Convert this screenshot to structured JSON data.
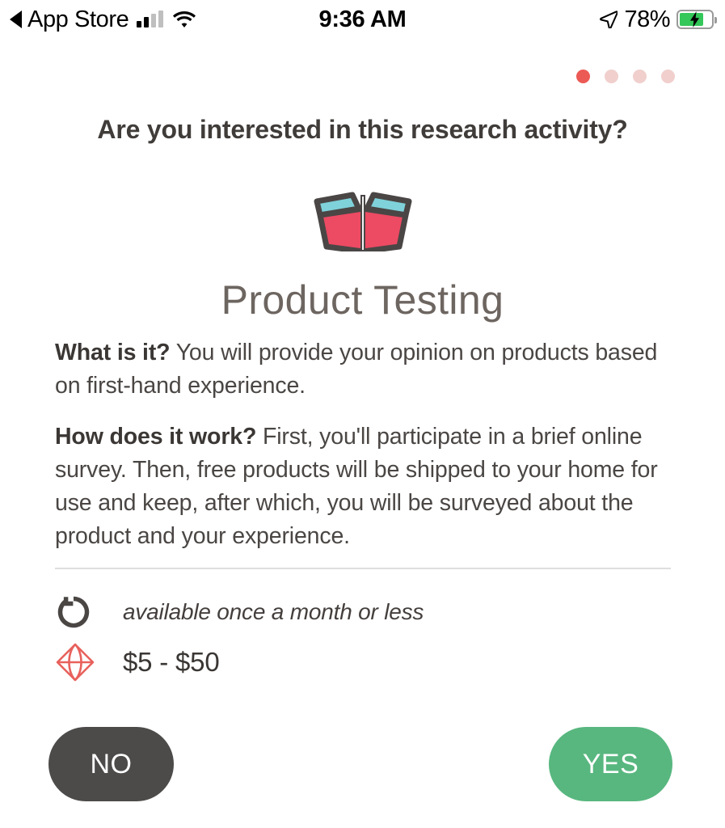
{
  "status_bar": {
    "back_label": "App Store",
    "back_icon": "back-triangle-icon",
    "signal_icon": "cellular-signal-icon",
    "wifi_icon": "wifi-icon",
    "time": "9:36 AM",
    "location_icon": "location-arrow-icon",
    "battery_percent": "78%",
    "battery_icon": "battery-charging-icon",
    "battery_level": 75
  },
  "pagination": {
    "total": 4,
    "active_index": 0,
    "active_color": "#ec5a55",
    "inactive_color": "#f0cfcc"
  },
  "header": {
    "question": "Are you interested in this research activity?"
  },
  "hero": {
    "icon": "open-box-icon",
    "box_body_color": "#ed4a63",
    "box_flap_color": "#7fd2da",
    "box_outline_color": "#4a4645",
    "title": "Product Testing"
  },
  "details": {
    "paragraphs": [
      {
        "lead": "What is it?",
        "text": " You will provide your opinion on products based on first-hand experience."
      },
      {
        "lead": "How does it work?",
        "text": " First, you'll participate in a brief online survey. Then, free products will be shipped to your home for use and keep, after which, you will be surveyed about the product and your experience."
      }
    ]
  },
  "meta": [
    {
      "icon": "repeat-refresh-icon",
      "icon_color": "#4a4644",
      "text": "available once a month or less",
      "style": "italic"
    },
    {
      "icon": "gem-diamond-icon",
      "icon_color": "#e8615c",
      "text": "$5 - $50",
      "style": "amount"
    }
  ],
  "actions": {
    "decline_label": "NO",
    "decline_color": "#4d4b4a",
    "accept_label": "YES",
    "accept_color": "#58b77f"
  }
}
